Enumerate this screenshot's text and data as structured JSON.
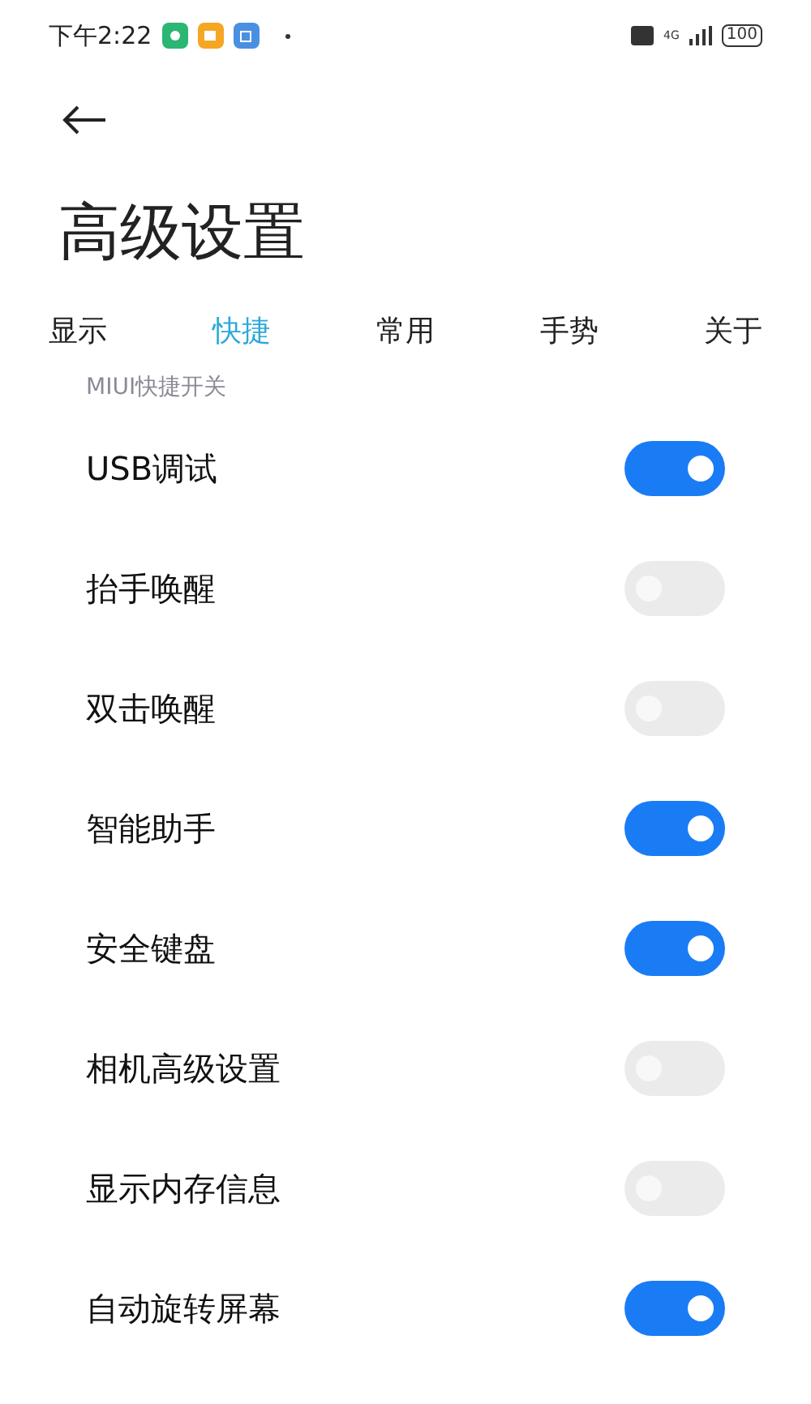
{
  "status_bar": {
    "time": "下午2:22",
    "network": "4G",
    "battery": "100"
  },
  "title": "高级设置",
  "tabs": [
    {
      "label": "显示",
      "selected": false
    },
    {
      "label": "快捷",
      "selected": true
    },
    {
      "label": "常用",
      "selected": false
    },
    {
      "label": "手势",
      "selected": false
    },
    {
      "label": "关于",
      "selected": false
    }
  ],
  "section": "MIUI快捷开关",
  "settings": [
    {
      "label": "USB调试",
      "on": true
    },
    {
      "label": "抬手唤醒",
      "on": false
    },
    {
      "label": "双击唤醒",
      "on": false
    },
    {
      "label": "智能助手",
      "on": true
    },
    {
      "label": "安全键盘",
      "on": true
    },
    {
      "label": "相机高级设置",
      "on": false
    },
    {
      "label": "显示内存信息",
      "on": false
    },
    {
      "label": "自动旋转屏幕",
      "on": true
    }
  ]
}
